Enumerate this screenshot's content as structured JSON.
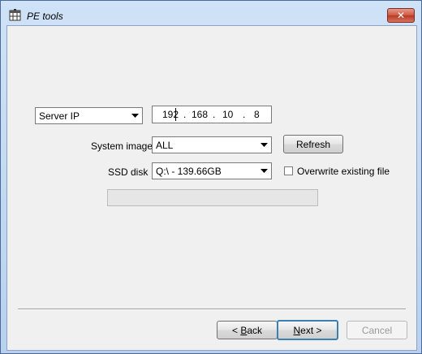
{
  "window": {
    "title": "PE tools",
    "close_glyph": "✕"
  },
  "source_select": {
    "value": "Server IP"
  },
  "ip_address": {
    "octet1": "192",
    "octet2": "168",
    "octet3": "10",
    "octet4": "8",
    "separator": "."
  },
  "system_image": {
    "label": "System image",
    "value": "ALL"
  },
  "refresh_button": {
    "label": "Refresh"
  },
  "ssd_disk": {
    "label": "SSD disk",
    "value": "Q:\\ - 139.66GB"
  },
  "overwrite": {
    "label": "Overwrite existing file",
    "checked": false
  },
  "progress": {
    "value": 0
  },
  "footer": {
    "back_prefix": "< ",
    "back_mnemonic": "B",
    "back_rest": "ack",
    "next_mnemonic": "N",
    "next_rest": "ext >",
    "cancel_label": "Cancel"
  },
  "icons": {
    "app": "app-window-icon",
    "close": "close-icon",
    "dropdown": "chevron-down-icon"
  },
  "colors": {
    "titlebar": "#cfe2f7",
    "close_button": "#cc5742",
    "client_bg": "#f0f0f0",
    "default_button_border": "#3c7fb1"
  }
}
